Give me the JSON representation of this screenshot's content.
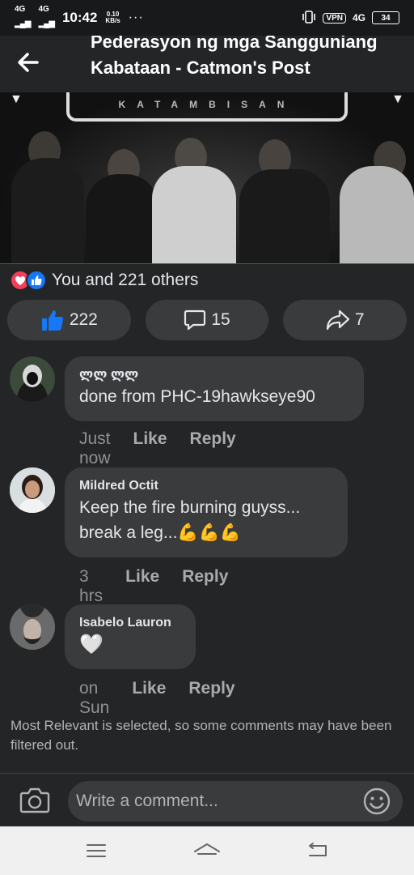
{
  "status_bar": {
    "network_1": "4G",
    "network_2": "4G",
    "time": "10:42",
    "speed_value": "0.10",
    "speed_unit": "KB/s",
    "more": "···",
    "vpn": "VPN",
    "network_right": "4G",
    "battery": "34"
  },
  "header": {
    "title": "Pederasyon ng mga Sangguniang Kabataan - Catmon's Post"
  },
  "post_image": {
    "banner_text": "KATAMBISAN"
  },
  "reactions": {
    "summary": "You and 221 others"
  },
  "actions": {
    "like_count": "222",
    "comment_count": "15",
    "share_count": "7"
  },
  "comments": [
    {
      "name": "ლლ ლლ",
      "text": "done from PHC-19hawkseye90",
      "time": "Just now",
      "like": "Like",
      "reply": "Reply"
    },
    {
      "name": "Mildred Octit",
      "text_line1": "Keep the fire burning guyss...",
      "text_line2": "break a leg...💪💪💪",
      "time": "3 hrs",
      "like": "Like",
      "reply": "Reply"
    },
    {
      "name": "Isabelo Lauron",
      "text": "🤍",
      "time": "on Sun",
      "like": "Like",
      "reply": "Reply"
    }
  ],
  "filter_note": "Most Relevant is selected, so some comments may have been filtered out.",
  "composer": {
    "placeholder": "Write a comment..."
  },
  "colors": {
    "background": "#242526",
    "bubble": "#3a3b3c",
    "like_blue": "#1877f2",
    "love_red": "#f33e58"
  }
}
